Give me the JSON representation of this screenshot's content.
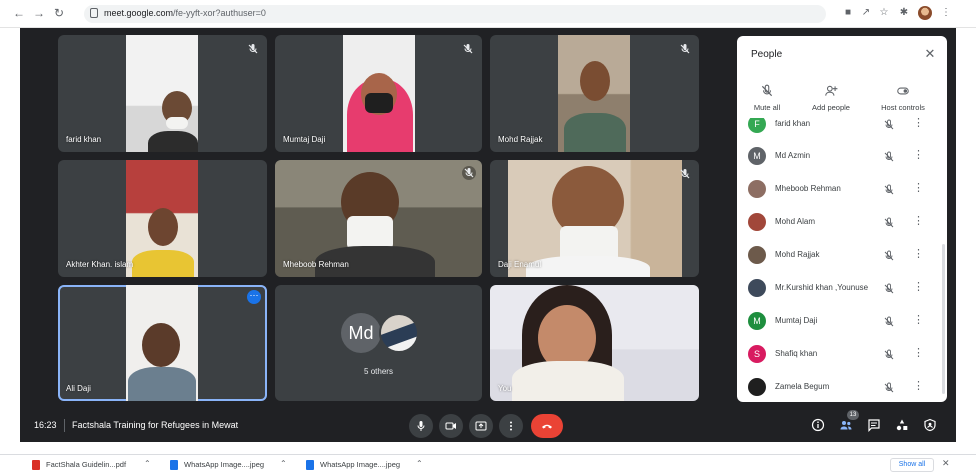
{
  "browser": {
    "url_host": "meet.google.com",
    "url_path": "/fe-yyft-xor?authuser=0"
  },
  "tiles": [
    {
      "name": "farid khan",
      "muted": true
    },
    {
      "name": "Mumtaj Daji",
      "muted": true
    },
    {
      "name": "Mohd Rajjak",
      "muted": true
    },
    {
      "name": "Akhter Khan. islam",
      "muted": false
    },
    {
      "name": "Mheboob Rehman",
      "muted": true
    },
    {
      "name": "Daji Enamul",
      "muted": true
    },
    {
      "name": "Ali Daji",
      "muted": false
    },
    {
      "name": "",
      "muted": false
    },
    {
      "name": "You",
      "muted": false
    }
  ],
  "others_tile": {
    "avatar_initials": "Md",
    "label": "5 others"
  },
  "people_panel": {
    "title": "People",
    "actions": [
      "Mute all",
      "Add people",
      "Host controls"
    ],
    "participants": [
      {
        "name": "farid khan",
        "initial": "F",
        "color": "#34a853"
      },
      {
        "name": "Md Azmin",
        "initial": "M",
        "color": "#5f6368"
      },
      {
        "name": "Mheboob Rehman",
        "initial": "",
        "color": "#8d6e63"
      },
      {
        "name": "Mohd Alam",
        "initial": "",
        "color": "#a1473a"
      },
      {
        "name": "Mohd Rajjak",
        "initial": "",
        "color": "#6d5a4b"
      },
      {
        "name": "Mr.Kurshid khan ,Younuse",
        "initial": "",
        "color": "#3e4a5b"
      },
      {
        "name": "Mumtaj Daji",
        "initial": "M",
        "color": "#1e8e3e"
      },
      {
        "name": "Shafiq khan",
        "initial": "S",
        "color": "#d81b60"
      },
      {
        "name": "Zamela Begum",
        "initial": "",
        "color": "#1f1f1f"
      }
    ]
  },
  "control_bar": {
    "time": "16:23",
    "meeting_title": "Factshala Training for Refugees in Mewat",
    "participant_count": "13"
  },
  "downloads": {
    "items": [
      {
        "name": "FactShala Guidelin...pdf",
        "type": "pdf"
      },
      {
        "name": "WhatsApp Image....jpeg",
        "type": "image"
      },
      {
        "name": "WhatsApp Image....jpeg",
        "type": "image"
      }
    ],
    "show_all": "Show all"
  },
  "colors": {
    "meet_bg": "#202124",
    "tile_bg": "#3c4043",
    "end_call": "#ea4335",
    "selected_outline": "#8ab4f8",
    "accent": "#1a73e8"
  }
}
